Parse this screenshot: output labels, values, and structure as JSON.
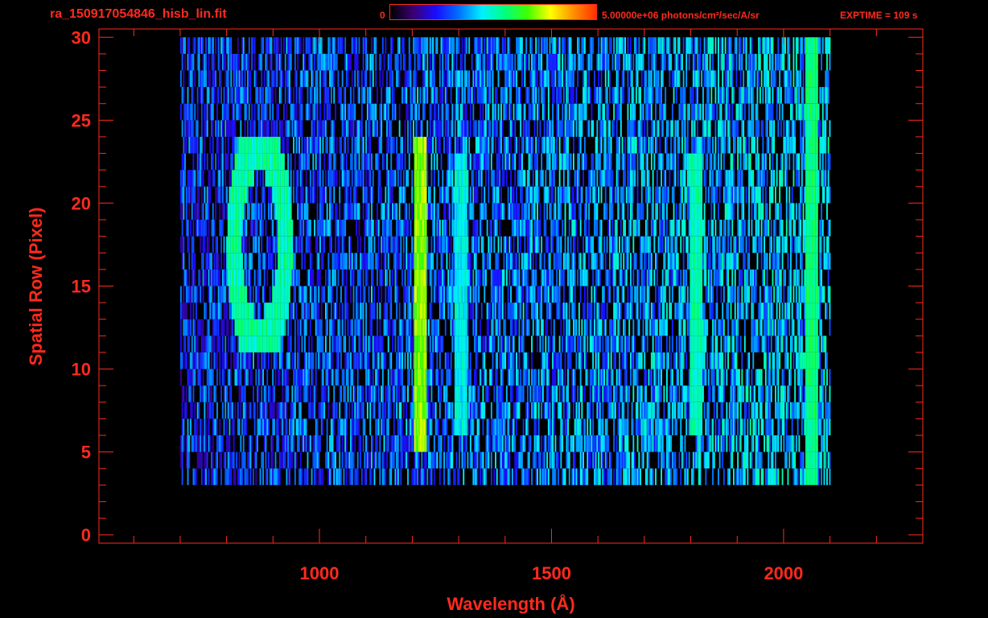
{
  "header": {
    "file_name": "ra_150917054846_hisb_lin.fit",
    "colorbar_min": "0",
    "colorbar_max_label": "5.00000e+06 photons/cm²/sec/A/sr",
    "exptime": "EXPTIME = 109 s"
  },
  "colors": {
    "axes": "#ff2a1e",
    "background": "#000000",
    "colormap": [
      "#000000",
      "#3a0070",
      "#1a0cff",
      "#0070ff",
      "#00f0ff",
      "#00ff80",
      "#40ff00",
      "#ffff00",
      "#ff9000",
      "#ff3000"
    ]
  },
  "chart_data": {
    "type": "heatmap",
    "title": "",
    "xlabel": "Wavelength (Å)",
    "ylabel": "Spatial Row (Pixel)",
    "xlim": [
      525,
      2300
    ],
    "ylim": [
      -0.5,
      30.5
    ],
    "xticks": [
      1000,
      1500,
      2000
    ],
    "xtick_labels": [
      "1000",
      "1500",
      "2000"
    ],
    "yticks": [
      0,
      5,
      10,
      15,
      20,
      25,
      30
    ],
    "ytick_labels": [
      "0",
      "5",
      "10",
      "15",
      "20",
      "25",
      "30"
    ],
    "grid": false,
    "color_range": [
      0,
      5000000
    ],
    "data_x_range": [
      700,
      2100
    ],
    "data_row_range": [
      3,
      30
    ],
    "features": [
      {
        "wavelength": 1216,
        "rows": [
          5,
          24
        ],
        "intensity": 0.75
      },
      {
        "wavelength": 1304,
        "rows": [
          6,
          23
        ],
        "intensity": 0.5
      },
      {
        "wavelength": 1810,
        "rows": [
          6,
          23
        ],
        "intensity": 0.55
      },
      {
        "wavelength": 2060,
        "rows": [
          3,
          30
        ],
        "intensity": 0.6
      }
    ]
  }
}
